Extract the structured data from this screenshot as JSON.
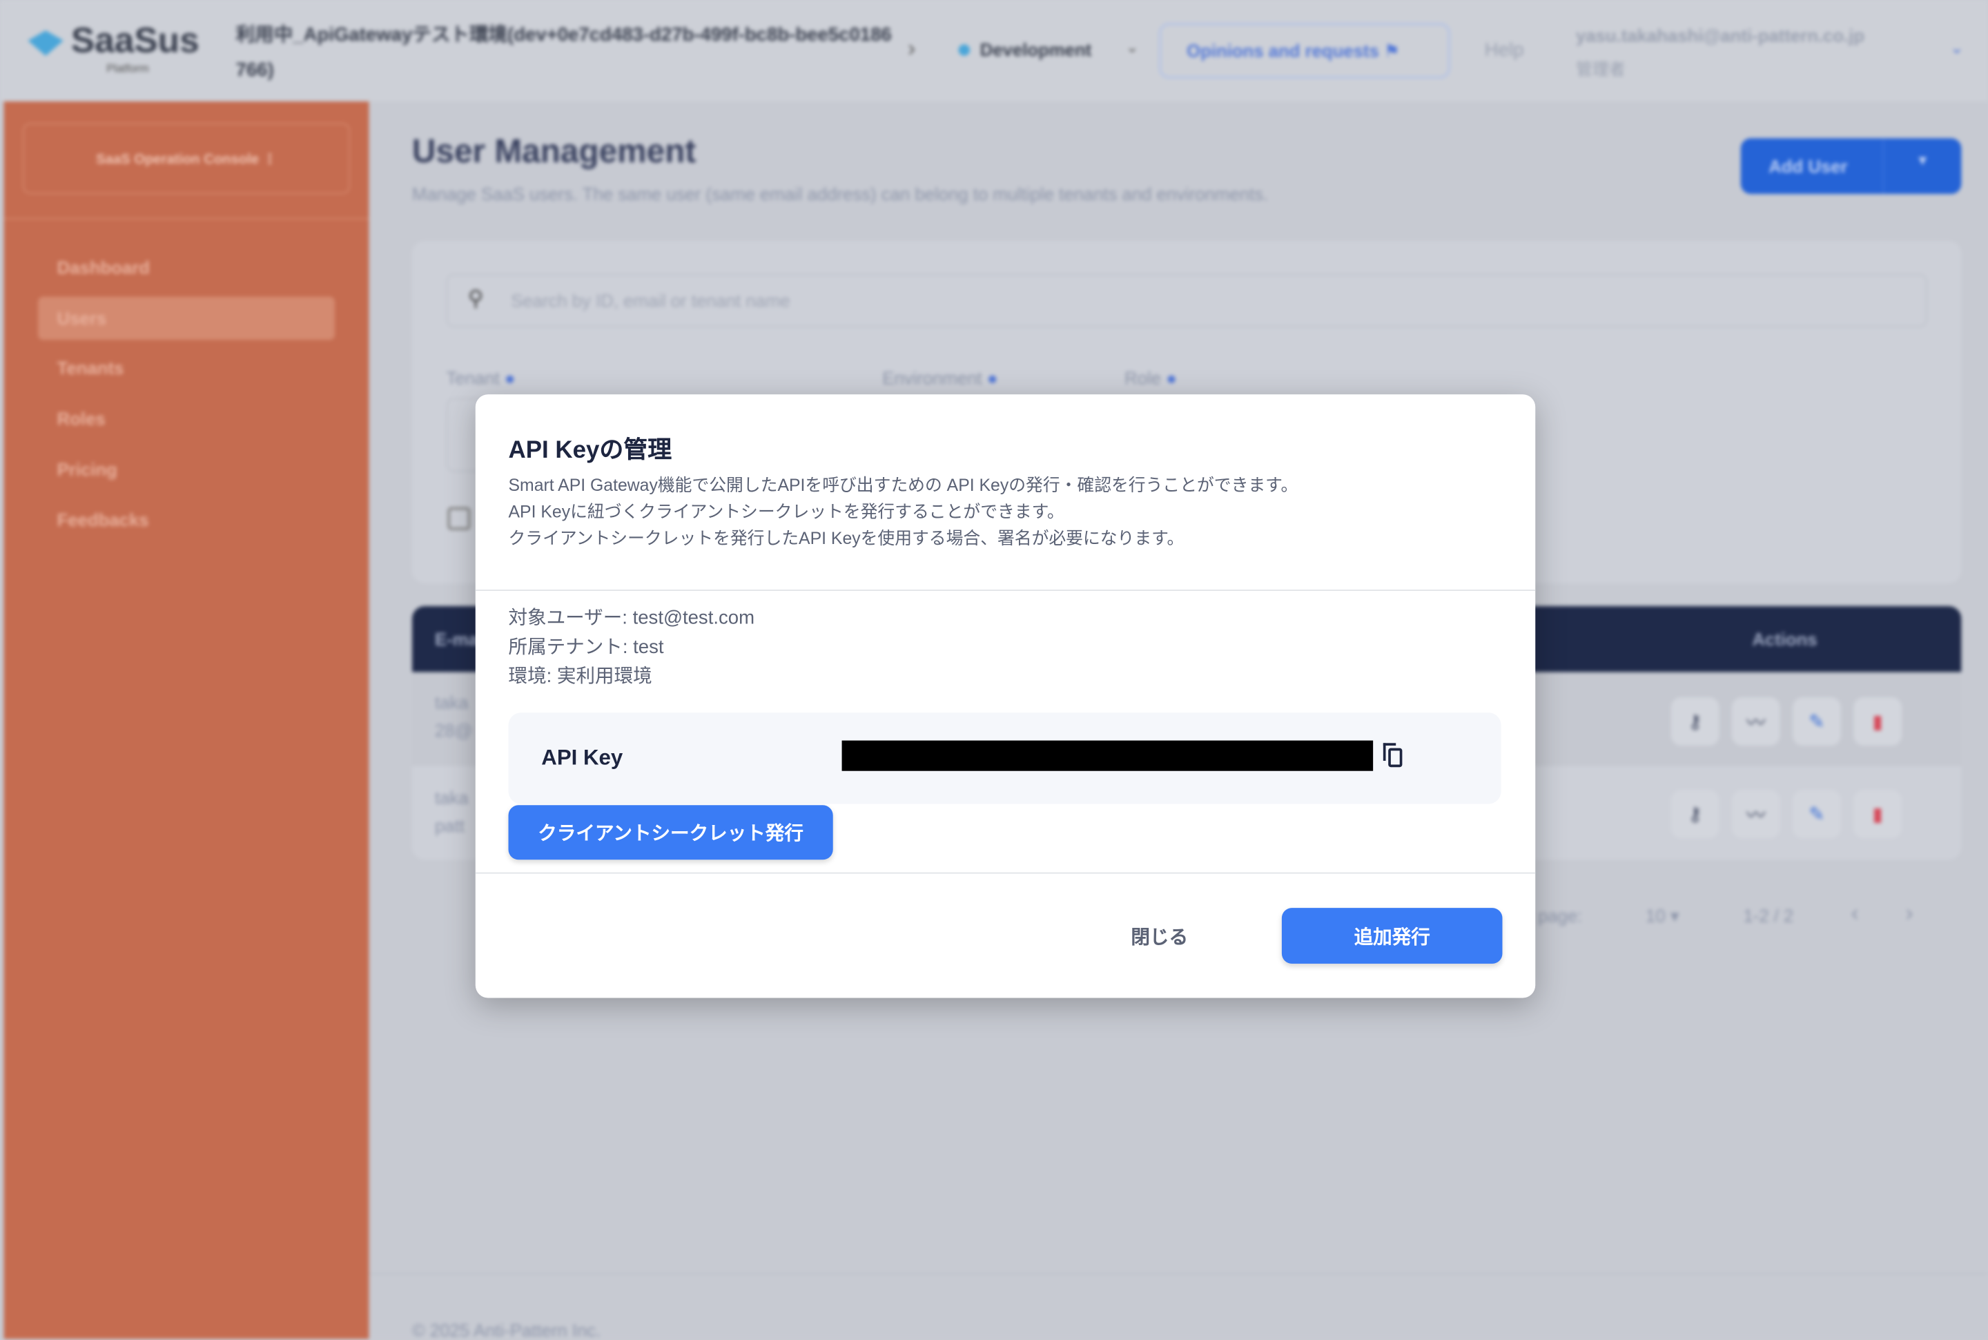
{
  "header": {
    "logo": "SaaSus",
    "logo_sub": "Platform",
    "env_path": "利用中_ApiGatewayテスト環境(dev+0e7cd483-d27b-499f-bc8b-bee5c0186766)",
    "env_select": "Development",
    "opinions": "Opinions and requests",
    "help": "Help",
    "user_email": "yasu.takahashi@anti-pattern.co.jp",
    "user_role": "管理者"
  },
  "sidebar": {
    "console": "SaaS Operation Console",
    "items": [
      {
        "label": "Dashboard"
      },
      {
        "label": "Users"
      },
      {
        "label": "Tenants"
      },
      {
        "label": "Roles"
      },
      {
        "label": "Pricing"
      },
      {
        "label": "Feedbacks"
      }
    ]
  },
  "main": {
    "title": "User Management",
    "subtitle": "Manage SaaS users. The same user (same email address) can belong to multiple tenants and environments.",
    "add_user": "Add User",
    "search_placeholder": "Search by ID, email or tenant name",
    "filters": {
      "tenant": "Tenant",
      "environment": "Environment",
      "role": "Role"
    },
    "table": {
      "col_email": "E-mail",
      "col_actions": "Actions",
      "rows": [
        {
          "email_a": "taka",
          "email_b": "28@"
        },
        {
          "email_a": "taka",
          "email_b": "patt"
        }
      ]
    },
    "pagination": {
      "per_page_label": "Rows per page:",
      "per_page": "10",
      "range": "1-2 / 2"
    },
    "footer": "© 2025 Anti-Pattern Inc."
  },
  "modal": {
    "title": "API Keyの管理",
    "desc": [
      "Smart API Gateway機能で公開したAPIを呼び出すための API Keyの発行・確認を行うことができます。",
      "API Keyに紐づくクライアントシークレットを発行することができます。",
      "クライアントシークレットを発行したAPI Keyを使用する場合、署名が必要になります。"
    ],
    "info": [
      "対象ユーザー: test@test.com",
      "所属テナント: test",
      "環境: 実利用環境"
    ],
    "api_key_label": "API Key",
    "issue_secret": "クライアントシークレット発行",
    "close": "閉じる",
    "add_issue": "追加発行"
  },
  "colors": {
    "accent": "#3a7cf5",
    "sidebar": "#c56c50",
    "table_header": "#1f2a4a"
  }
}
